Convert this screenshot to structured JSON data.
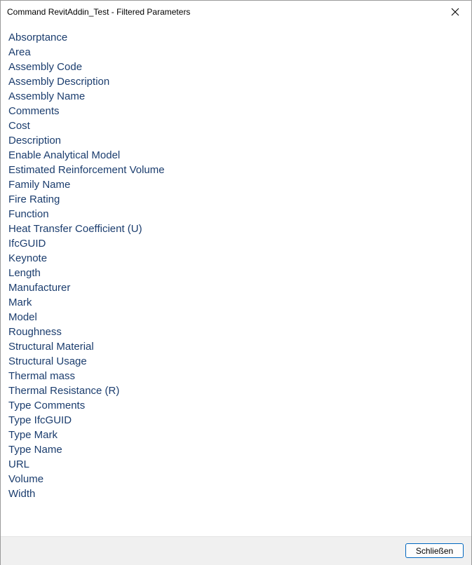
{
  "window": {
    "title": "Command RevitAddin_Test - Filtered Parameters",
    "close_icon": "close-icon"
  },
  "parameters": [
    "Absorptance",
    "Area",
    "Assembly Code",
    "Assembly Description",
    "Assembly Name",
    "Comments",
    "Cost",
    "Description",
    "Enable Analytical Model",
    "Estimated Reinforcement Volume",
    "Family Name",
    "Fire Rating",
    "Function",
    "Heat Transfer Coefficient (U)",
    "IfcGUID",
    "Keynote",
    "Length",
    "Manufacturer",
    "Mark",
    "Model",
    "Roughness",
    "Structural Material",
    "Structural Usage",
    "Thermal mass",
    "Thermal Resistance (R)",
    "Type Comments",
    "Type IfcGUID",
    "Type Mark",
    "Type Name",
    "URL",
    "Volume",
    "Width"
  ],
  "footer": {
    "close_label": "Schließen"
  },
  "colors": {
    "list_text": "#1b3d6e",
    "button_border": "#0067c0",
    "footer_bg": "#f0f0f0"
  }
}
